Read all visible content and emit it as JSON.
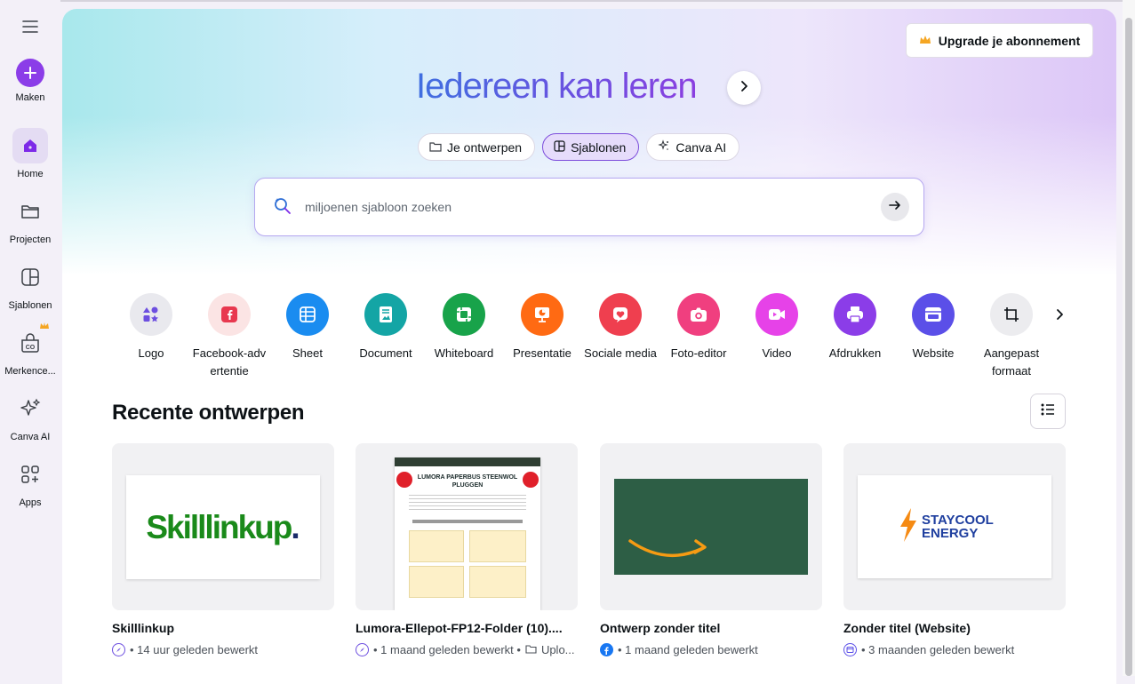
{
  "sidebar": {
    "items": [
      {
        "label": "Maken",
        "icon": "plus-icon"
      },
      {
        "label": "Home",
        "icon": "home-icon"
      },
      {
        "label": "Projecten",
        "icon": "folder-icon"
      },
      {
        "label": "Sjablonen",
        "icon": "template-icon"
      },
      {
        "label": "Merkence...",
        "icon": "brand-icon"
      },
      {
        "label": "Canva AI",
        "icon": "sparkle-icon"
      },
      {
        "label": "Apps",
        "icon": "apps-icon"
      }
    ]
  },
  "header": {
    "upgrade_label": "Upgrade je abonnement",
    "headline": "Iedereen kan leren"
  },
  "tabs": [
    {
      "label": "Je ontwerpen"
    },
    {
      "label": "Sjablonen"
    },
    {
      "label": "Canva AI"
    }
  ],
  "search": {
    "placeholder": "miljoenen sjabloon zoeken",
    "value": ""
  },
  "categories": [
    {
      "label": "Logo",
      "color": "#e9e9ee"
    },
    {
      "label": "Facebook-advertentie",
      "color": "#fbe4e4"
    },
    {
      "label": "Sheet",
      "color": "#1a8cf0"
    },
    {
      "label": "Document",
      "color": "#14a5a5"
    },
    {
      "label": "Whiteboard",
      "color": "#18a34a"
    },
    {
      "label": "Presentatie",
      "color": "#ff6a13"
    },
    {
      "label": "Sociale media",
      "color": "#ef3f4f"
    },
    {
      "label": "Foto-editor",
      "color": "#f03f7f"
    },
    {
      "label": "Video",
      "color": "#e642e8"
    },
    {
      "label": "Afdrukken",
      "color": "#8b3de8"
    },
    {
      "label": "Website",
      "color": "#5b4fe8"
    },
    {
      "label": "Aangepast formaat",
      "color": "#ececef"
    }
  ],
  "recent": {
    "title": "Recente ontwerpen",
    "items": [
      {
        "title": "Skilllinkup",
        "meta": "• 14 uur geleden bewerkt",
        "thumb_text": "Skilllinkup"
      },
      {
        "title": "Lumora-Ellepot-FP12-Folder (10)....",
        "meta": "• 1 maand geleden bewerkt •",
        "extra": "Uplo...",
        "thumb_text": "LUMORA PAPERBUS STEENWOL PLUGGEN"
      },
      {
        "title": "Ontwerp zonder titel",
        "meta": "• 1 maand geleden bewerkt",
        "thumb_text": ""
      },
      {
        "title": "Zonder titel (Website)",
        "meta": "• 3 maanden geleden bewerkt",
        "thumb_text": "STAYCOOL ENERGY"
      }
    ]
  },
  "colors": {
    "accent": "#7d2ae8",
    "brand_green": "#1a8a1a"
  }
}
